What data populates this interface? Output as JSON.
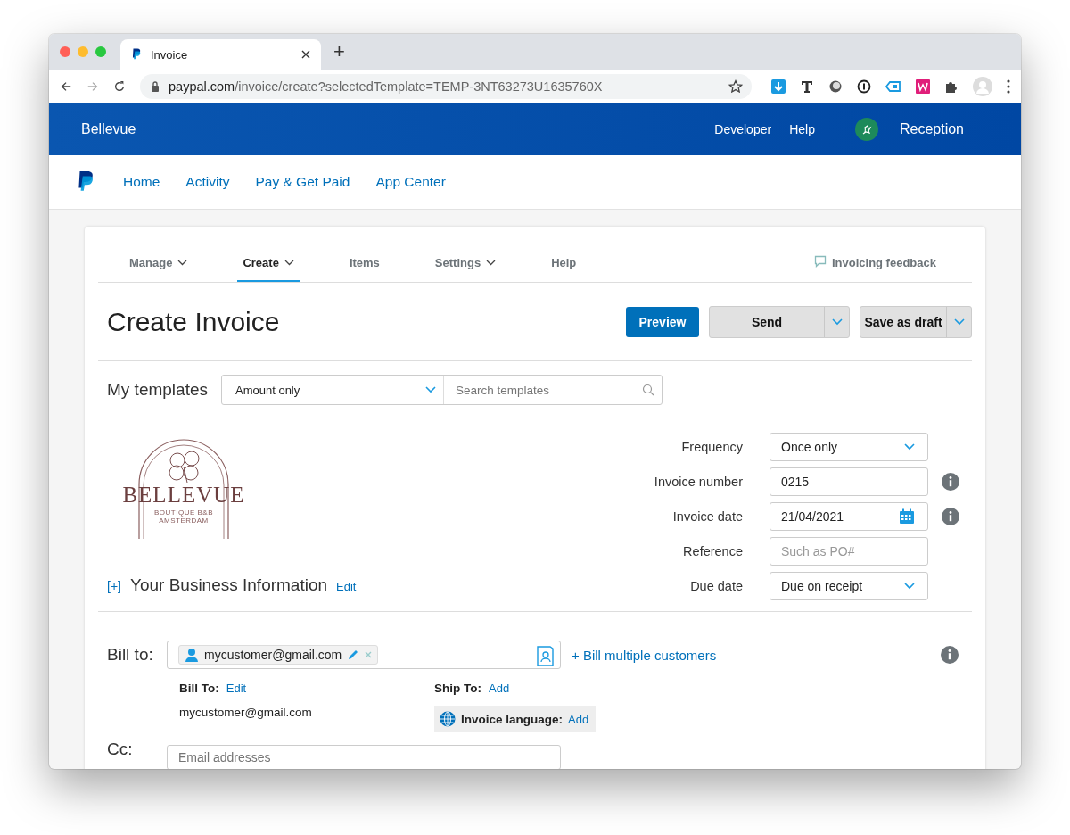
{
  "browser": {
    "tab_title": "Invoice",
    "new_tab": "+",
    "url_host": "paypal.com",
    "url_path": "/invoice/create?selectedTemplate=TEMP-3NT63273U1635760X"
  },
  "header": {
    "business": "Bellevue",
    "links": [
      "Developer",
      "Help"
    ],
    "user": "Reception"
  },
  "nav": [
    "Home",
    "Activity",
    "Pay & Get Paid",
    "App Center"
  ],
  "subtabs": [
    {
      "label": "Manage",
      "dropdown": true,
      "selected": false
    },
    {
      "label": "Create",
      "dropdown": true,
      "selected": true
    },
    {
      "label": "Items",
      "dropdown": false,
      "selected": false
    },
    {
      "label": "Settings",
      "dropdown": true,
      "selected": false
    },
    {
      "label": "Help",
      "dropdown": false,
      "selected": false
    }
  ],
  "feedback": "Invoicing feedback",
  "title": "Create Invoice",
  "buttons": {
    "preview": "Preview",
    "send": "Send",
    "draft": "Save as draft"
  },
  "templates": {
    "label": "My templates",
    "value": "Amount only",
    "search_placeholder": "Search templates"
  },
  "logo": {
    "name": "BELLEVUE",
    "line1": "BOUTIQUE B&B",
    "line2": "AMSTERDAM"
  },
  "business_info": {
    "toggle": "[+]",
    "label": "Your Business Information",
    "edit": "Edit"
  },
  "fields": [
    {
      "label": "Frequency",
      "kind": "select",
      "value": "Once only",
      "info": false
    },
    {
      "label": "Invoice number",
      "kind": "text",
      "value": "0215",
      "info": true
    },
    {
      "label": "Invoice date",
      "kind": "date",
      "value": "21/04/2021",
      "info": true
    },
    {
      "label": "Reference",
      "kind": "text",
      "placeholder": "Such as PO#",
      "info": false
    },
    {
      "label": "Due date",
      "kind": "select",
      "value": "Due on receipt",
      "info": false
    }
  ],
  "bill_to": {
    "label": "Bill to:",
    "chip": "mycustomer@gmail.com",
    "multiple": "+ Bill multiple customers",
    "bill_label": "Bill To:",
    "bill_edit": "Edit",
    "bill_email": "mycustomer@gmail.com",
    "ship_label": "Ship To:",
    "ship_add": "Add",
    "language_label": "Invoice language:",
    "language_add": "Add"
  },
  "cc": {
    "label": "Cc:",
    "placeholder": "Email addresses"
  }
}
